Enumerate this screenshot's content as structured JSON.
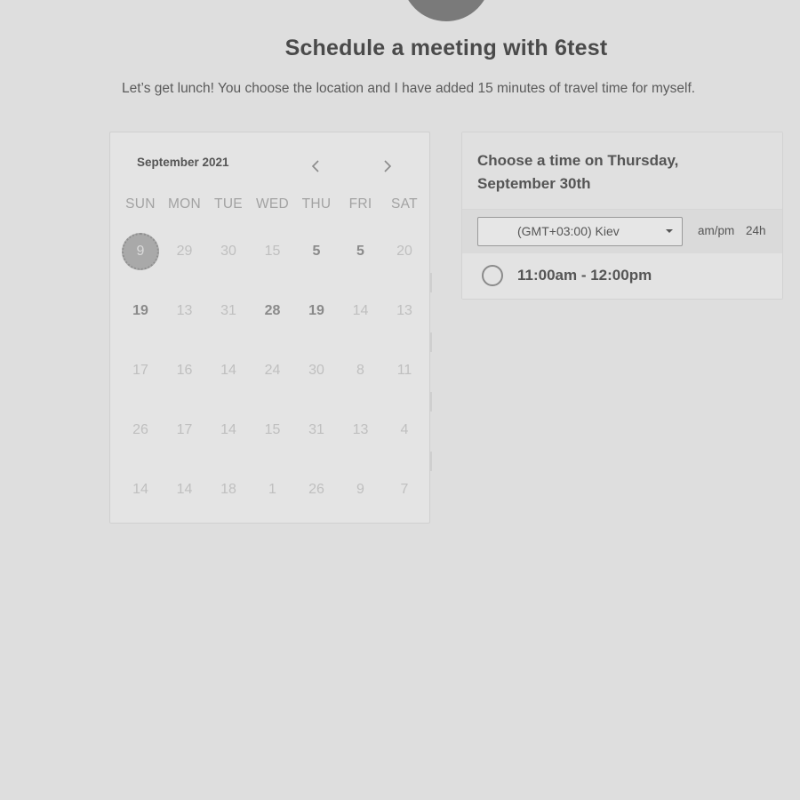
{
  "header": {
    "title": "Schedule a meeting with 6test",
    "description": "Let’s get lunch! You choose the location and I have added 15 minutes of travel time for myself."
  },
  "calendar": {
    "month_label": "September 2021",
    "weekdays": [
      "SUN",
      "MON",
      "TUE",
      "WED",
      "THU",
      "FRI",
      "SAT"
    ],
    "weeks": [
      [
        "9",
        "29",
        "30",
        "15",
        "5",
        "5",
        "20"
      ],
      [
        "19",
        "13",
        "31",
        "28",
        "19",
        "14",
        "13"
      ],
      [
        "17",
        "16",
        "14",
        "24",
        "30",
        "8",
        "11"
      ],
      [
        "26",
        "17",
        "14",
        "15",
        "31",
        "13",
        "4"
      ],
      [
        "14",
        "14",
        "18",
        "1",
        "26",
        "9",
        "7"
      ]
    ],
    "selected_day": "9"
  },
  "time_panel": {
    "title": "Choose a time on Thursday, September 30th",
    "timezone": "(GMT+03:00) Kiev",
    "format_ampm": "am/pm",
    "format_24h": "24h",
    "slots": [
      "11:00am - 12:00pm"
    ]
  }
}
